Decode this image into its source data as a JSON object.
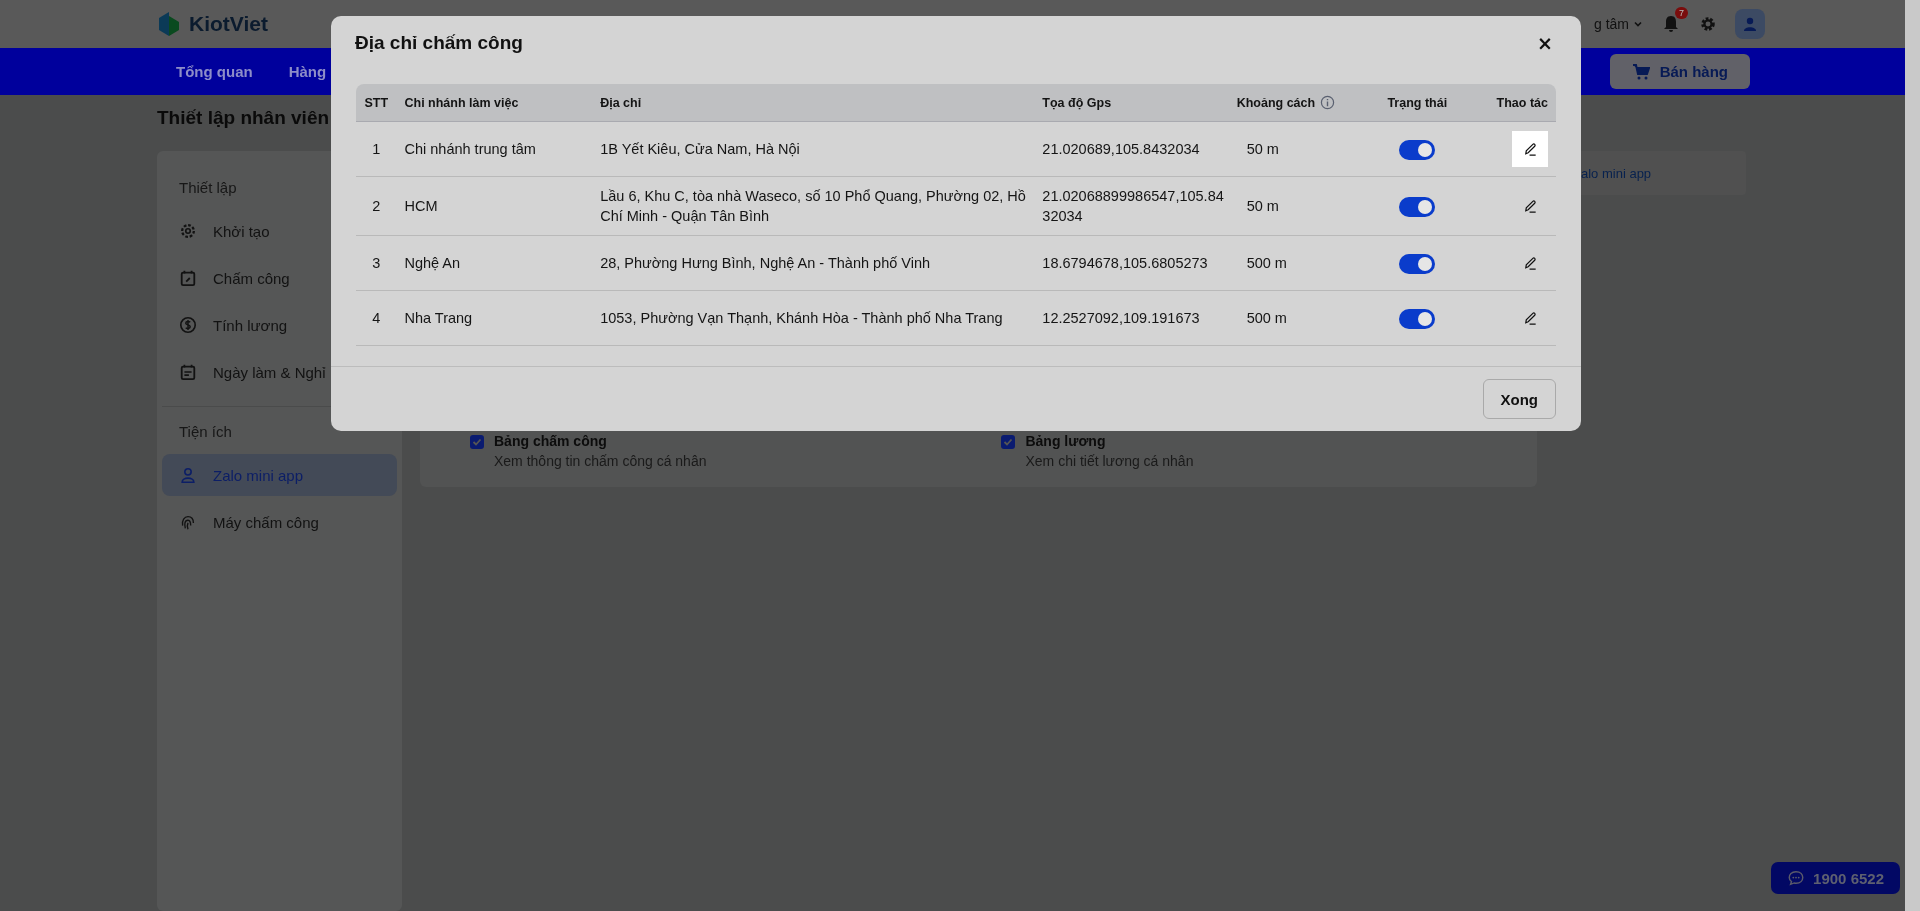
{
  "header": {
    "logo": "KiotViet",
    "branch": "g tâm",
    "notification_count": "7"
  },
  "nav": {
    "items": [
      {
        "label": "Tổng quan"
      },
      {
        "label": "Hàng"
      }
    ],
    "sell_button": "Bán hàng"
  },
  "page": {
    "title": "Thiết lập nhân viên"
  },
  "sidebar": {
    "groups": [
      {
        "title": "Thiết lập",
        "items": [
          {
            "label": "Khởi tạo",
            "selected": false
          },
          {
            "label": "Chấm công",
            "selected": false
          },
          {
            "label": "Tính lương",
            "selected": false
          },
          {
            "label": "Ngày làm & Nghỉ",
            "selected": false
          }
        ]
      },
      {
        "title": "Tiện ích",
        "items": [
          {
            "label": "Zalo mini app",
            "selected": true
          },
          {
            "label": "Máy chấm công",
            "selected": false
          }
        ]
      }
    ]
  },
  "features": [
    {
      "title": "Bảng chấm công",
      "description": "Xem thông tin chấm công cá nhân",
      "checked": true
    },
    {
      "title": "Bảng lương",
      "description": "Xem chi tiết lương cá nhân",
      "checked": true
    }
  ],
  "side_tag": "alo mini app",
  "modal": {
    "title": "Địa chỉ chấm công",
    "close": "×",
    "table": {
      "columns": [
        "STT",
        "Chi nhánh làm việc",
        "Địa chỉ",
        "Tọa độ Gps",
        "Khoảng cách",
        "Trạng thái",
        "Thao tác"
      ],
      "rows": [
        {
          "stt": "1",
          "branch": "Chi nhánh trung tâm",
          "address": "1B Yết Kiêu,  Cửa Nam,  Hà Nội",
          "gps": "21.020689,105.8432034",
          "distance": "50 m",
          "on": true,
          "edit_focused": true
        },
        {
          "stt": "2",
          "branch": "HCM",
          "address": "Lầu 6, Khu C, tòa nhà Waseco, số 10 Phổ Quang, Phường 02, Hồ Chí Minh - Quận Tân Bình",
          "gps": "21.02068899986547,105.8432034",
          "distance": "50 m",
          "on": true,
          "edit_focused": false
        },
        {
          "stt": "3",
          "branch": "Nghệ An",
          "address": "28, Phường Hưng Bình, Nghệ An - Thành phố Vinh",
          "gps": "18.6794678,105.6805273",
          "distance": "500 m",
          "on": true,
          "edit_focused": false
        },
        {
          "stt": "4",
          "branch": "Nha Trang",
          "address": "1053, Phường Vạn Thạnh, Khánh Hòa - Thành phố Nha Trang",
          "gps": "12.2527092,109.191673",
          "distance": "500 m",
          "on": true,
          "edit_focused": false
        }
      ]
    },
    "done_button": "Xong"
  },
  "hotline": "1900 6522"
}
